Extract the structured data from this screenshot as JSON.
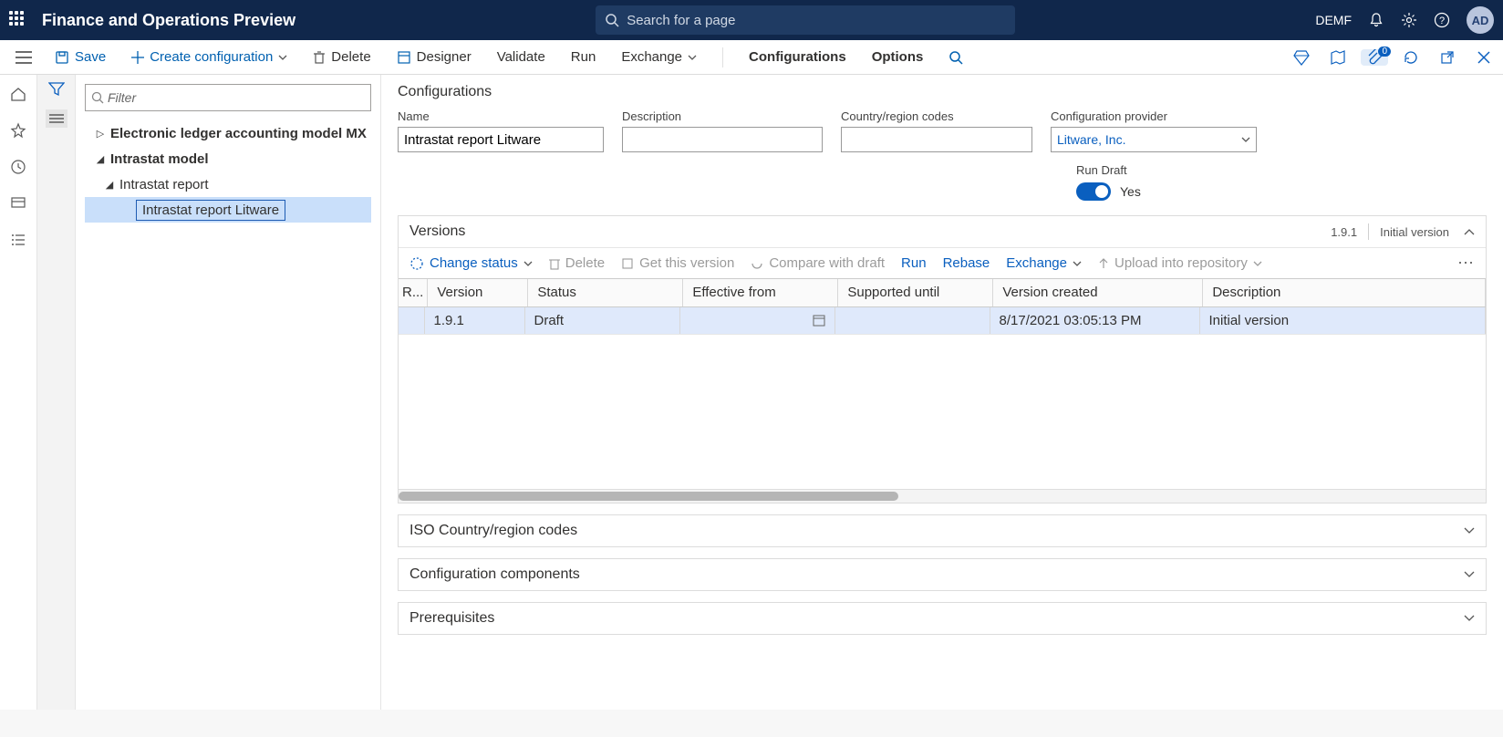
{
  "topbar": {
    "app_title": "Finance and Operations Preview",
    "search_placeholder": "Search for a page",
    "company": "DEMF",
    "avatar": "AD"
  },
  "cmdbar": {
    "save": "Save",
    "create": "Create configuration",
    "delete": "Delete",
    "designer": "Designer",
    "validate": "Validate",
    "run": "Run",
    "exchange": "Exchange",
    "configurations": "Configurations",
    "options": "Options",
    "badge_count": "0"
  },
  "tree": {
    "filter_placeholder": "Filter",
    "nodes": [
      {
        "label": "Electronic ledger accounting model MX",
        "bold": true,
        "caret": "right",
        "indent": 1
      },
      {
        "label": "Intrastat model",
        "bold": true,
        "caret": "down",
        "indent": 1
      },
      {
        "label": "Intrastat report",
        "bold": false,
        "caret": "down",
        "indent": 2
      },
      {
        "label": "Intrastat report Litware",
        "bold": false,
        "caret": "",
        "indent": 3,
        "selected": true
      }
    ]
  },
  "config": {
    "section_title": "Configurations",
    "labels": {
      "name": "Name",
      "description": "Description",
      "country_codes": "Country/region codes",
      "provider": "Configuration provider",
      "run_draft": "Run Draft"
    },
    "values": {
      "name": "Intrastat report Litware",
      "description": "",
      "country_codes": "",
      "provider": "Litware, Inc.",
      "run_draft_state": "Yes"
    }
  },
  "versions": {
    "title": "Versions",
    "summary_version": "1.9.1",
    "summary_text": "Initial version",
    "actions": {
      "change_status": "Change status",
      "delete": "Delete",
      "get_version": "Get this version",
      "compare": "Compare with draft",
      "run": "Run",
      "rebase": "Rebase",
      "exchange": "Exchange",
      "upload": "Upload into repository"
    },
    "columns": [
      "R...",
      "Version",
      "Status",
      "Effective from",
      "Supported until",
      "Version created",
      "Description"
    ],
    "rows": [
      {
        "r": "",
        "version": "1.9.1",
        "status": "Draft",
        "effective_from": "",
        "supported_until": "",
        "created": "8/17/2021 03:05:13 PM",
        "description": "Initial version"
      }
    ]
  },
  "fasttabs": {
    "iso": "ISO Country/region codes",
    "components": "Configuration components",
    "prereq": "Prerequisites"
  }
}
